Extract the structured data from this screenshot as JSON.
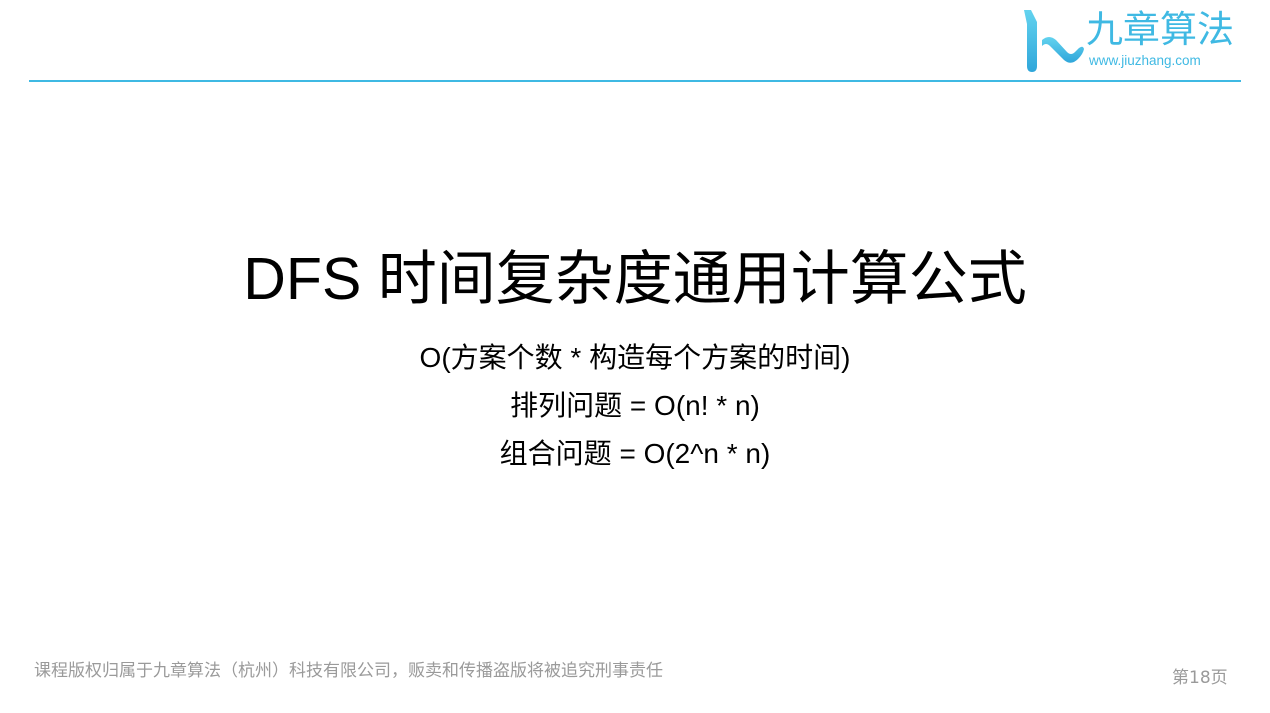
{
  "header": {
    "logo_name": "九章算法",
    "logo_url": "www.jiuzhang.com",
    "logo_icon": "jiuzhang-logo-icon",
    "accent_color": "#3fb9e3"
  },
  "slide": {
    "title": "DFS 时间复杂度通用计算公式",
    "lines": [
      "O(方案个数 * 构造每个方案的时间)",
      "排列问题 = O(n! * n)",
      "组合问题 = O(2^n * n)"
    ]
  },
  "footer": {
    "copyright": "课程版权归属于九章算法（杭州）科技有限公司，贩卖和传播盗版将被追究刑事责任",
    "page_number": "第18页"
  }
}
